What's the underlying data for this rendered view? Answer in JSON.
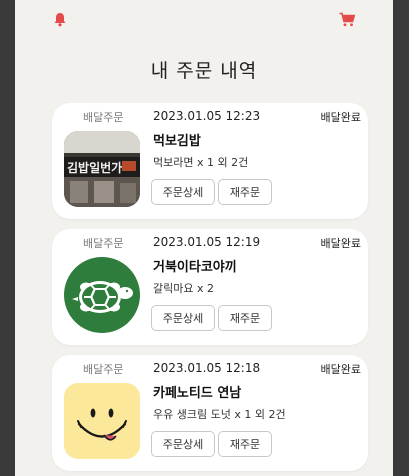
{
  "header": {
    "notification_icon": "bell-icon",
    "cart_icon": "cart-icon",
    "accent_color": "#e34b4b"
  },
  "page_title": "내 주문 내역",
  "orders": [
    {
      "delivery_type": "배달주문",
      "date": "2023.01.05 12:23",
      "status": "배달완료",
      "store": "먹보김밥",
      "items": "먹보라면 x 1 외 2건",
      "thumbnail": "storefront-photo",
      "thumbnail_sign_text": "김밥일번가",
      "detail_label": "주문상세",
      "reorder_label": "재주문"
    },
    {
      "delivery_type": "배달주문",
      "date": "2023.01.05 12:19",
      "status": "배달완료",
      "store": "거북이타코야끼",
      "items": "갈릭마요 x 2",
      "thumbnail": "turtle-logo",
      "detail_label": "주문상세",
      "reorder_label": "재주문"
    },
    {
      "delivery_type": "배달주문",
      "date": "2023.01.05 12:18",
      "status": "배달완료",
      "store": "카페노티드 연남",
      "items": "우유 생크림 도넛 x 1 외 2건",
      "thumbnail": "smiley-logo",
      "detail_label": "주문상세",
      "reorder_label": "재주문"
    }
  ]
}
